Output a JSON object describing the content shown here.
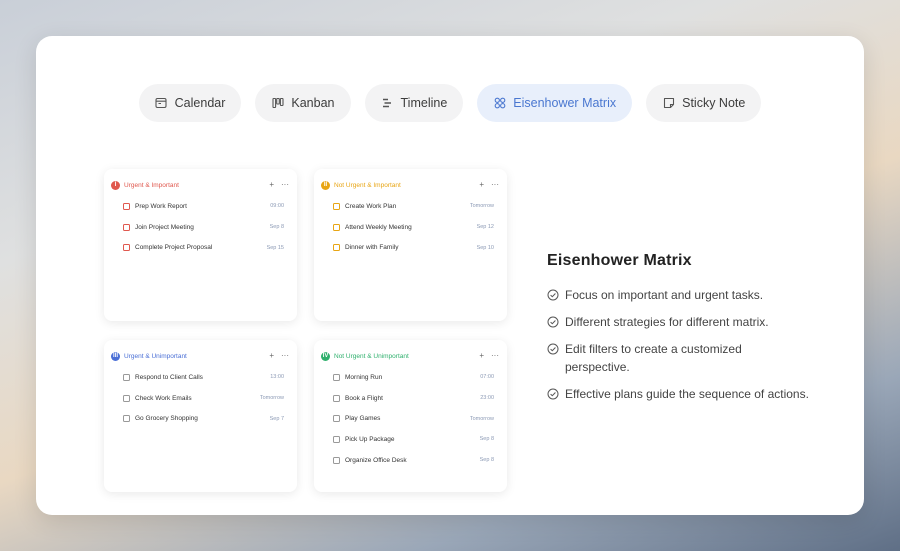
{
  "tabs": [
    {
      "label": "Calendar",
      "icon": "calendar-icon",
      "active": false
    },
    {
      "label": "Kanban",
      "icon": "kanban-icon",
      "active": false
    },
    {
      "label": "Timeline",
      "icon": "timeline-icon",
      "active": false
    },
    {
      "label": "Eisenhower Matrix",
      "icon": "matrix-icon",
      "active": true
    },
    {
      "label": "Sticky Note",
      "icon": "sticky-note-icon",
      "active": false
    }
  ],
  "quadrants": [
    {
      "badge": "I",
      "title": "Urgent & Important",
      "color": "#e0584e",
      "add": "+",
      "more": "···",
      "tasks": [
        {
          "name": "Prep Work Report",
          "date": "09:00"
        },
        {
          "name": "Join Project Meeting",
          "date": "Sep 8"
        },
        {
          "name": "Complete Project Proposal",
          "date": "Sep 15"
        }
      ]
    },
    {
      "badge": "II",
      "title": "Not Urgent & Important",
      "color": "#e8a514",
      "add": "+",
      "more": "···",
      "tasks": [
        {
          "name": "Create Work Plan",
          "date": "Tomorrow"
        },
        {
          "name": "Attend Weekly Meeting",
          "date": "Sep 12"
        },
        {
          "name": "Dinner with Family",
          "date": "Sep 10"
        }
      ]
    },
    {
      "badge": "III",
      "title": "Urgent & Unimportant",
      "color": "#4a6fd6",
      "add": "+",
      "more": "···",
      "tasks": [
        {
          "name": "Respond to Client Calls",
          "date": "13:00"
        },
        {
          "name": "Check Work Emails",
          "date": "Tomorrow"
        },
        {
          "name": "Go Grocery Shopping",
          "date": "Sep 7"
        }
      ]
    },
    {
      "badge": "IV",
      "title": "Not Urgent & Unimportant",
      "color": "#2fb06d",
      "add": "+",
      "more": "···",
      "tasks": [
        {
          "name": "Morning Run",
          "date": "07:00"
        },
        {
          "name": "Book a Flight",
          "date": "23:00"
        },
        {
          "name": "Play Games",
          "date": "Tomorrow"
        },
        {
          "name": "Pick Up Package",
          "date": "Sep 8"
        },
        {
          "name": "Organize Office Desk",
          "date": "Sep 8"
        }
      ]
    }
  ],
  "info": {
    "title": "Eisenhower Matrix",
    "features": [
      "Focus on important and urgent tasks.",
      "Different strategies for different matrix.",
      "Edit filters to create a customized perspective.",
      "Effective plans guide the sequence of actions."
    ]
  }
}
